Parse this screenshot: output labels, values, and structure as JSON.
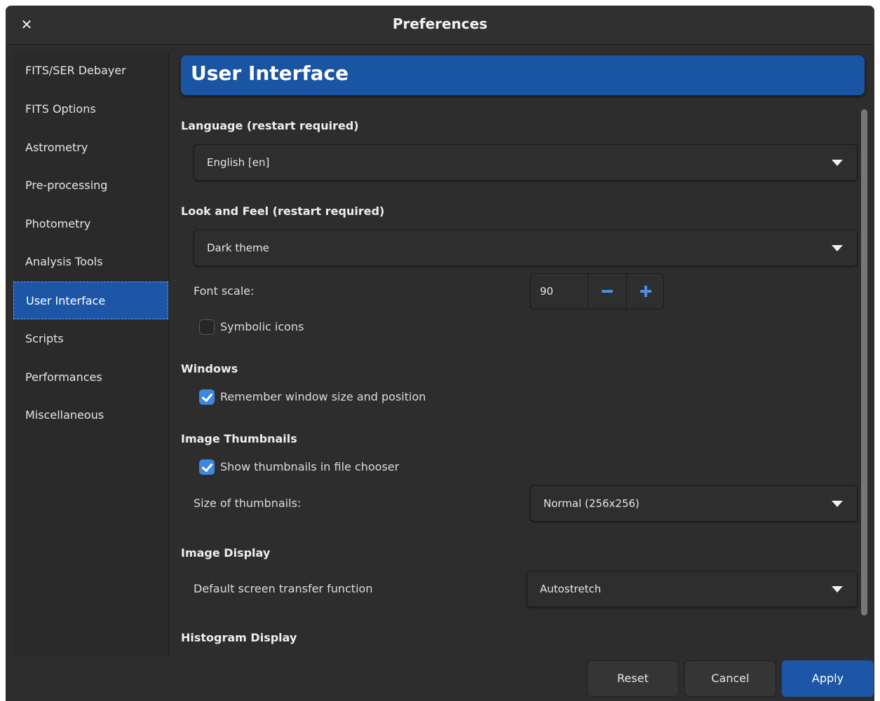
{
  "window": {
    "title": "Preferences",
    "close_icon": "close-icon"
  },
  "sidebar": {
    "items": [
      {
        "label": "FITS/SER Debayer"
      },
      {
        "label": "FITS Options"
      },
      {
        "label": "Astrometry"
      },
      {
        "label": "Pre-processing"
      },
      {
        "label": "Photometry"
      },
      {
        "label": "Analysis Tools"
      },
      {
        "label": "User Interface",
        "selected": true
      },
      {
        "label": "Scripts"
      },
      {
        "label": "Performances"
      },
      {
        "label": "Miscellaneous"
      }
    ]
  },
  "page": {
    "header": "User Interface",
    "language": {
      "section": "Language (restart required)",
      "value": "English [en]"
    },
    "look": {
      "section": "Look and Feel (restart required)",
      "value": "Dark theme",
      "font_scale_label": "Font scale:",
      "font_scale_value": "90",
      "symbolic_icons_label": "Symbolic icons",
      "symbolic_icons_checked": false
    },
    "windows": {
      "section": "Windows",
      "remember_label": "Remember window size and position",
      "remember_checked": true
    },
    "thumbnails": {
      "section": "Image Thumbnails",
      "show_label": "Show thumbnails in file chooser",
      "show_checked": true,
      "size_label": "Size of thumbnails:",
      "size_value": "Normal (256x256)"
    },
    "display": {
      "section": "Image Display",
      "stf_label": "Default screen transfer function",
      "stf_value": "Autostretch"
    },
    "histogram": {
      "section": "Histogram Display"
    }
  },
  "buttons": {
    "reset": "Reset",
    "cancel": "Cancel",
    "apply": "Apply"
  },
  "colors": {
    "accent": "#1d56a6",
    "background": "#2d2d2d",
    "checkbox": "#3f86df"
  }
}
